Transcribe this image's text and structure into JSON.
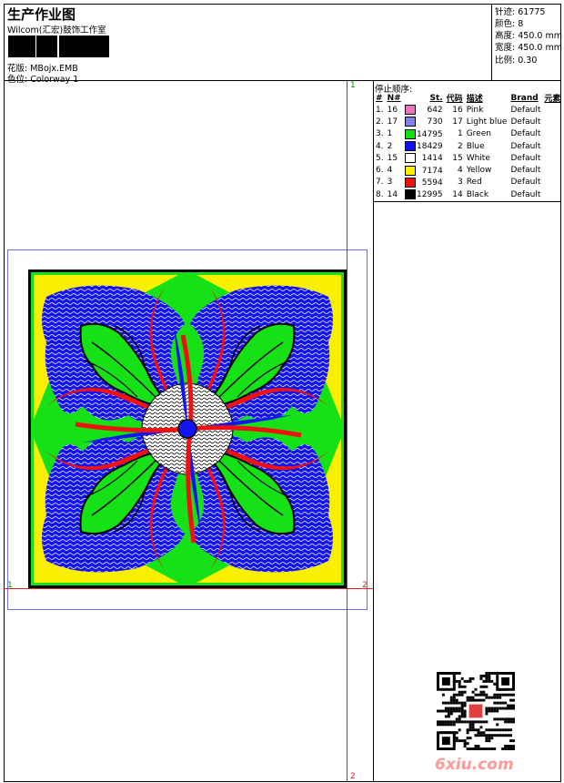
{
  "header": {
    "title": "生产作业图",
    "company": "Wilcom(汇宏)鼓饰工作室",
    "design_label": "花版:",
    "design_name": "MBojx.EMB",
    "colorway_label": "色位:",
    "colorway_name": "Colorway 1"
  },
  "stats": [
    {
      "label": "针迹:",
      "value": "61775"
    },
    {
      "label": "颜色:",
      "value": "8"
    },
    {
      "label": "高度:",
      "value": "450.0 mm"
    },
    {
      "label": "宽度:",
      "value": "450.0 mm"
    },
    {
      "label": "比例:",
      "value": "0.30"
    }
  ],
  "sequence": {
    "title": "停止顺序:",
    "headers": [
      "#",
      "N#",
      "St.",
      "代码",
      "描述",
      "Brand",
      "元素"
    ],
    "rows": [
      {
        "idx": "1.",
        "n": "16",
        "color": "#f070c0",
        "st": "642",
        "code": "16",
        "desc": "Pink",
        "brand": "Default"
      },
      {
        "idx": "2.",
        "n": "17",
        "color": "#8080f0",
        "st": "730",
        "code": "17",
        "desc": "Light blue",
        "brand": "Default"
      },
      {
        "idx": "3.",
        "n": "1",
        "color": "#10e010",
        "st": "14795",
        "code": "1",
        "desc": "Green",
        "brand": "Default"
      },
      {
        "idx": "4.",
        "n": "2",
        "color": "#1010f0",
        "st": "18429",
        "code": "2",
        "desc": "Blue",
        "brand": "Default"
      },
      {
        "idx": "5.",
        "n": "15",
        "color": "#ffffff",
        "st": "1414",
        "code": "15",
        "desc": "White",
        "brand": "Default"
      },
      {
        "idx": "6.",
        "n": "4",
        "color": "#f8f000",
        "st": "7174",
        "code": "4",
        "desc": "Yellow",
        "brand": "Default"
      },
      {
        "idx": "7.",
        "n": "3",
        "color": "#f01010",
        "st": "5594",
        "code": "3",
        "desc": "Red",
        "brand": "Default"
      },
      {
        "idx": "8.",
        "n": "14",
        "color": "#000000",
        "st": "12995",
        "code": "14",
        "desc": "Black",
        "brand": "Default"
      }
    ]
  },
  "rulers": {
    "top": "1",
    "bottom": "2",
    "left": "1",
    "right": "2"
  },
  "watermark": "6xiu.com",
  "colors": {
    "ruler": "#e02020",
    "bbox": "#7070e0",
    "watermark": "#ff9999"
  }
}
